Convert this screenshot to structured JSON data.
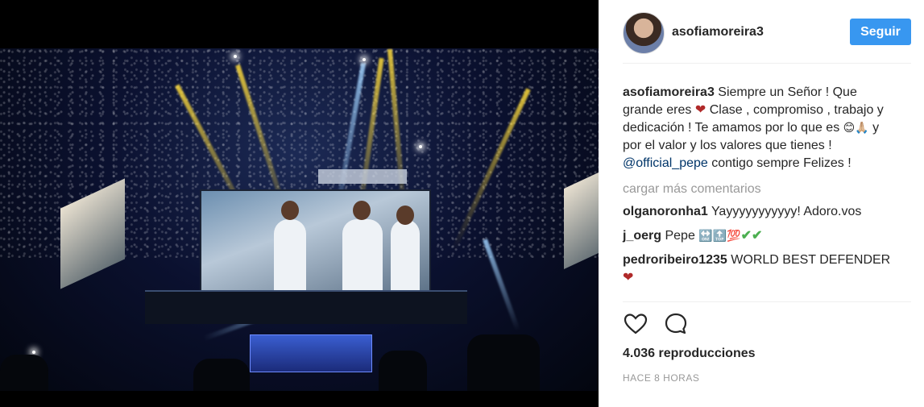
{
  "post": {
    "username": "asofiamoreira3",
    "follow_label": "Seguir",
    "caption": {
      "author": "asofiamoreira3",
      "text_1": "Siempre un Señor ! Que grande eres",
      "heart": "❤",
      "text_2": "Clase , compromiso , trabajo y dedicación ! Te amamos por lo que es",
      "emoji": "😊🙏🏼",
      "text_3": "y por el valor y los valores que tienes !",
      "mention": "@official_pepe",
      "text_4": "contigo sempre Felizes !"
    },
    "load_more": "cargar más comentarios",
    "comments": [
      {
        "user": "olganoronha1",
        "text": "Yayyyyyyyyyyy! Adoro.vos"
      },
      {
        "user": "j_oerg",
        "text": "Pepe",
        "emoji": "🔛🔝💯",
        "checks": "✔✔"
      },
      {
        "user": "pedroribeiro1235",
        "text": "WORLD BEST DEFENDER",
        "heart": "❤"
      }
    ],
    "views": "4.036 reproducciones",
    "time": "HACE 8 HORAS"
  },
  "icons": {
    "like": "heart-outline-icon",
    "comment": "speech-bubble-icon"
  },
  "colors": {
    "accent": "#3897f0",
    "heart": "#b02a2a",
    "mention": "#003569"
  }
}
